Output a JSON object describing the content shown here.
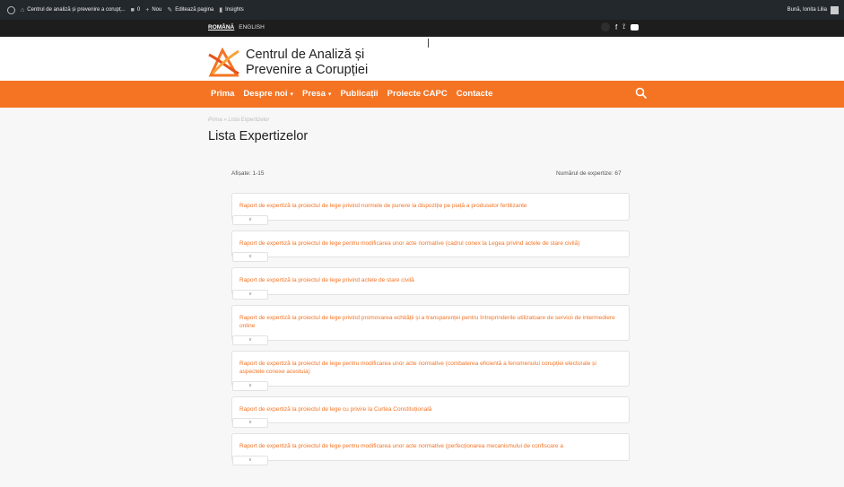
{
  "adminbar": {
    "site_name": "Centrul de analiză și prevenire a corupț...",
    "comments_count": "0",
    "new_label": "Nou",
    "edit_label": "Editează pagina",
    "insights_label": "Insights",
    "greeting": "Bună, Ionita Lilia"
  },
  "topbar": {
    "lang_ro": "ROMÂNĂ",
    "lang_en": "ENGLISH"
  },
  "header": {
    "brand_line1": "Centrul de Analiză și",
    "brand_line2": "Prevenire a Corupției"
  },
  "nav": {
    "items": [
      {
        "label": "Prima",
        "caret": ""
      },
      {
        "label": "Despre noi",
        "caret": "▾"
      },
      {
        "label": "Presa",
        "caret": "▾"
      },
      {
        "label": "Publicații",
        "caret": ""
      },
      {
        "label": "Proiecte CAPC",
        "caret": ""
      },
      {
        "label": "Contacte",
        "caret": ""
      }
    ]
  },
  "page": {
    "breadcrumb": "Prima » Lista Expertizelor",
    "title": "Lista Expertizelor",
    "shown": "Afișate: 1-15",
    "total": "Numărul de expertize: 67",
    "toggle": "∨"
  },
  "reports": [
    "Raport de expertiză la proiectul de lege privind normele de punere la dispoziție pe piață a produselor fertilizante",
    "Raport de expertiză la proiectul de lege pentru modificarea unor acte normative (cadrul conex la Legea privind actele de stare civilă)",
    "Raport de expertiză la proiectul de lege privind actele de stare civilă",
    "Raport de expertiză la proiectul de lege privind promovarea echității și a transparenței pentru întreprinderile utilizatoare de servicii de intermediere online",
    "Raport de expertiză la proiectul de lege pentru modificarea unor acte normative (combaterea eficientă a fenomenului corupției electorale și aspectele conexe acestuia)",
    "Raport de expertiză la proiectul de lege cu privire la Curtea Constituțională",
    "Raport de expertiză la proiectul de lege pentru modificarea unor acte normative (perfecționarea mecanismului de confiscare a"
  ],
  "colors": {
    "accent": "#f47424",
    "adminbar": "#23282d",
    "topbar": "#1d1d1d"
  }
}
